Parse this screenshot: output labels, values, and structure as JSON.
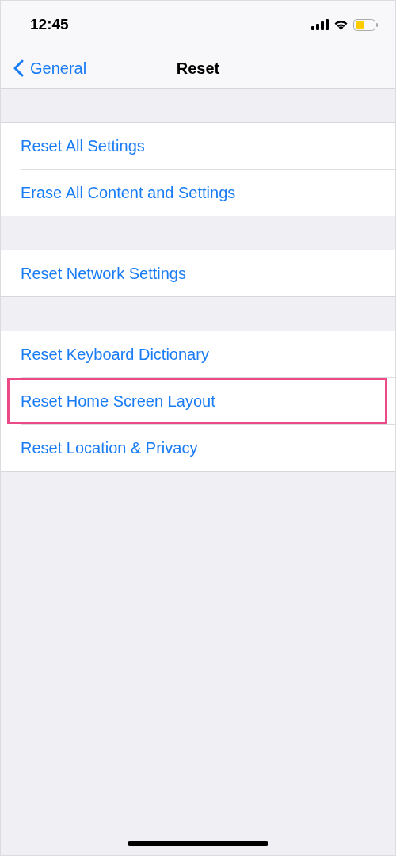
{
  "status_bar": {
    "time": "12:45"
  },
  "nav_bar": {
    "back_label": "General",
    "title": "Reset"
  },
  "groups": [
    {
      "items": [
        {
          "label": "Reset All Settings",
          "highlighted": false
        },
        {
          "label": "Erase All Content and Settings",
          "highlighted": false
        }
      ]
    },
    {
      "items": [
        {
          "label": "Reset Network Settings",
          "highlighted": false
        }
      ]
    },
    {
      "items": [
        {
          "label": "Reset Keyboard Dictionary",
          "highlighted": false
        },
        {
          "label": "Reset Home Screen Layout",
          "highlighted": true
        },
        {
          "label": "Reset Location & Privacy",
          "highlighted": false
        }
      ]
    }
  ]
}
